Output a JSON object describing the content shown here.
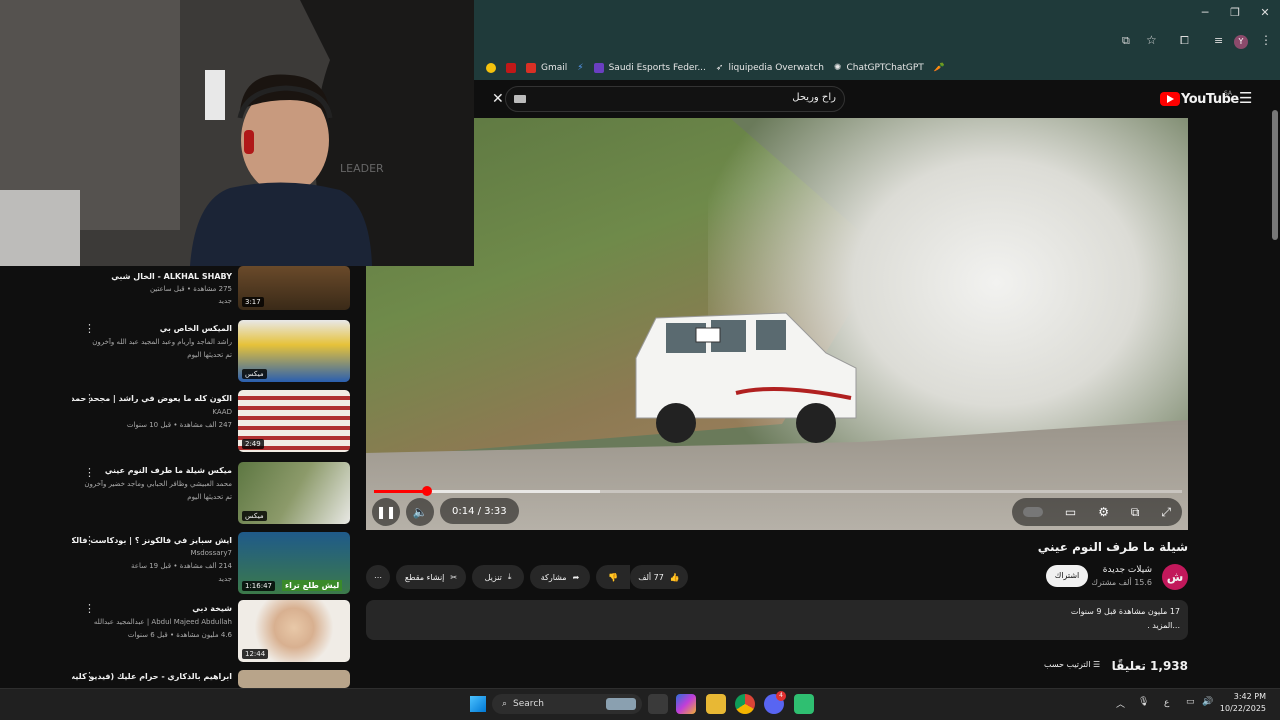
{
  "browser": {
    "bookmarks": [
      {
        "label": "Gmail",
        "color": "#d93025"
      },
      {
        "label": "Saudi Esports Feder...",
        "color": "#6a3fc1"
      },
      {
        "label": "liquipedia Overwatch",
        "color": "#ffffff"
      },
      {
        "label": "ChatGPTChatGPT",
        "color": "#ffffff"
      }
    ],
    "avatar_letter": "Y"
  },
  "youtube": {
    "logo": "YouTube",
    "region": "SA",
    "search_value": "راح وريحل"
  },
  "player": {
    "time": "0:14 / 3:33",
    "progress_fraction": 0.066,
    "buffered_fraction": 0.28
  },
  "video": {
    "title": "شيلة ما طرف النوم عيني",
    "channel_name": "شيلات جديدة",
    "channel_subs": "15.6 ألف مشترك",
    "channel_initial": "ش",
    "subscribe_label": "اشتراك",
    "likes": "77 ألف",
    "share_label": "مشاركة",
    "download_label": "تنزيل",
    "clip_label": "إنشاء مقطع",
    "description_stats": "17 مليون مشاهدة قبل 9 سنوات",
    "description_more": "...المزيد ."
  },
  "comments": {
    "count": "1,938 تعليقًا",
    "sort_label": "الترتيب حسب"
  },
  "sidebar": [
    {
      "title": "ALKHAL SHABY - الخال شبي",
      "meta1": "275 مشاهدة • قبل ساعتين",
      "meta2": "جديد",
      "duration": "3:17"
    },
    {
      "title": "الميكس الخاص بي",
      "meta1": "راشد الماجد وأريام وعبد المجيد عبد الله وآخرون",
      "meta2": "تم تحديثها اليوم",
      "duration": "ميكس"
    },
    {
      "title": "الكون كله ما يعوض في راشد | مجحد حمد",
      "meta1": "KAAD",
      "meta2": "247 ألف مشاهدة • قبل 10 سنوات",
      "duration": "2:49"
    },
    {
      "title": "ميكس شيلة ما طرف النوم عيني",
      "meta1": "محمد العبيشي وظافر الحبابي وماجد خضير وآخرون",
      "meta2": "تم تحديثها اليوم",
      "duration": "ميكس"
    },
    {
      "title": "ايش سبايز في فالكونز ؟ | بودكاست فالكونز",
      "meta1": "Msdossary7",
      "meta2": "214 ألف مشاهدة • قبل 19 ساعة",
      "meta3": "جديد",
      "duration": "1:16:47",
      "thumb_text": "ليش طلع تراء"
    },
    {
      "title": "شيخة دبي",
      "meta1": "Abdul Majeed Abdullah | عبدالمجيد عبدالله",
      "meta2": "4.6 مليون مشاهدة • قبل 6 سنوات",
      "duration": "12:44"
    },
    {
      "title": "ابراهيم بالذكاري - حرام عليك (فيديو كليب) |",
      "meta1": "",
      "meta2": "",
      "duration": ""
    }
  ],
  "taskbar": {
    "search_label": "Search",
    "time": "3:42 PM",
    "date": "10/22/2025",
    "lang": "ع",
    "discord_badge": "4"
  }
}
